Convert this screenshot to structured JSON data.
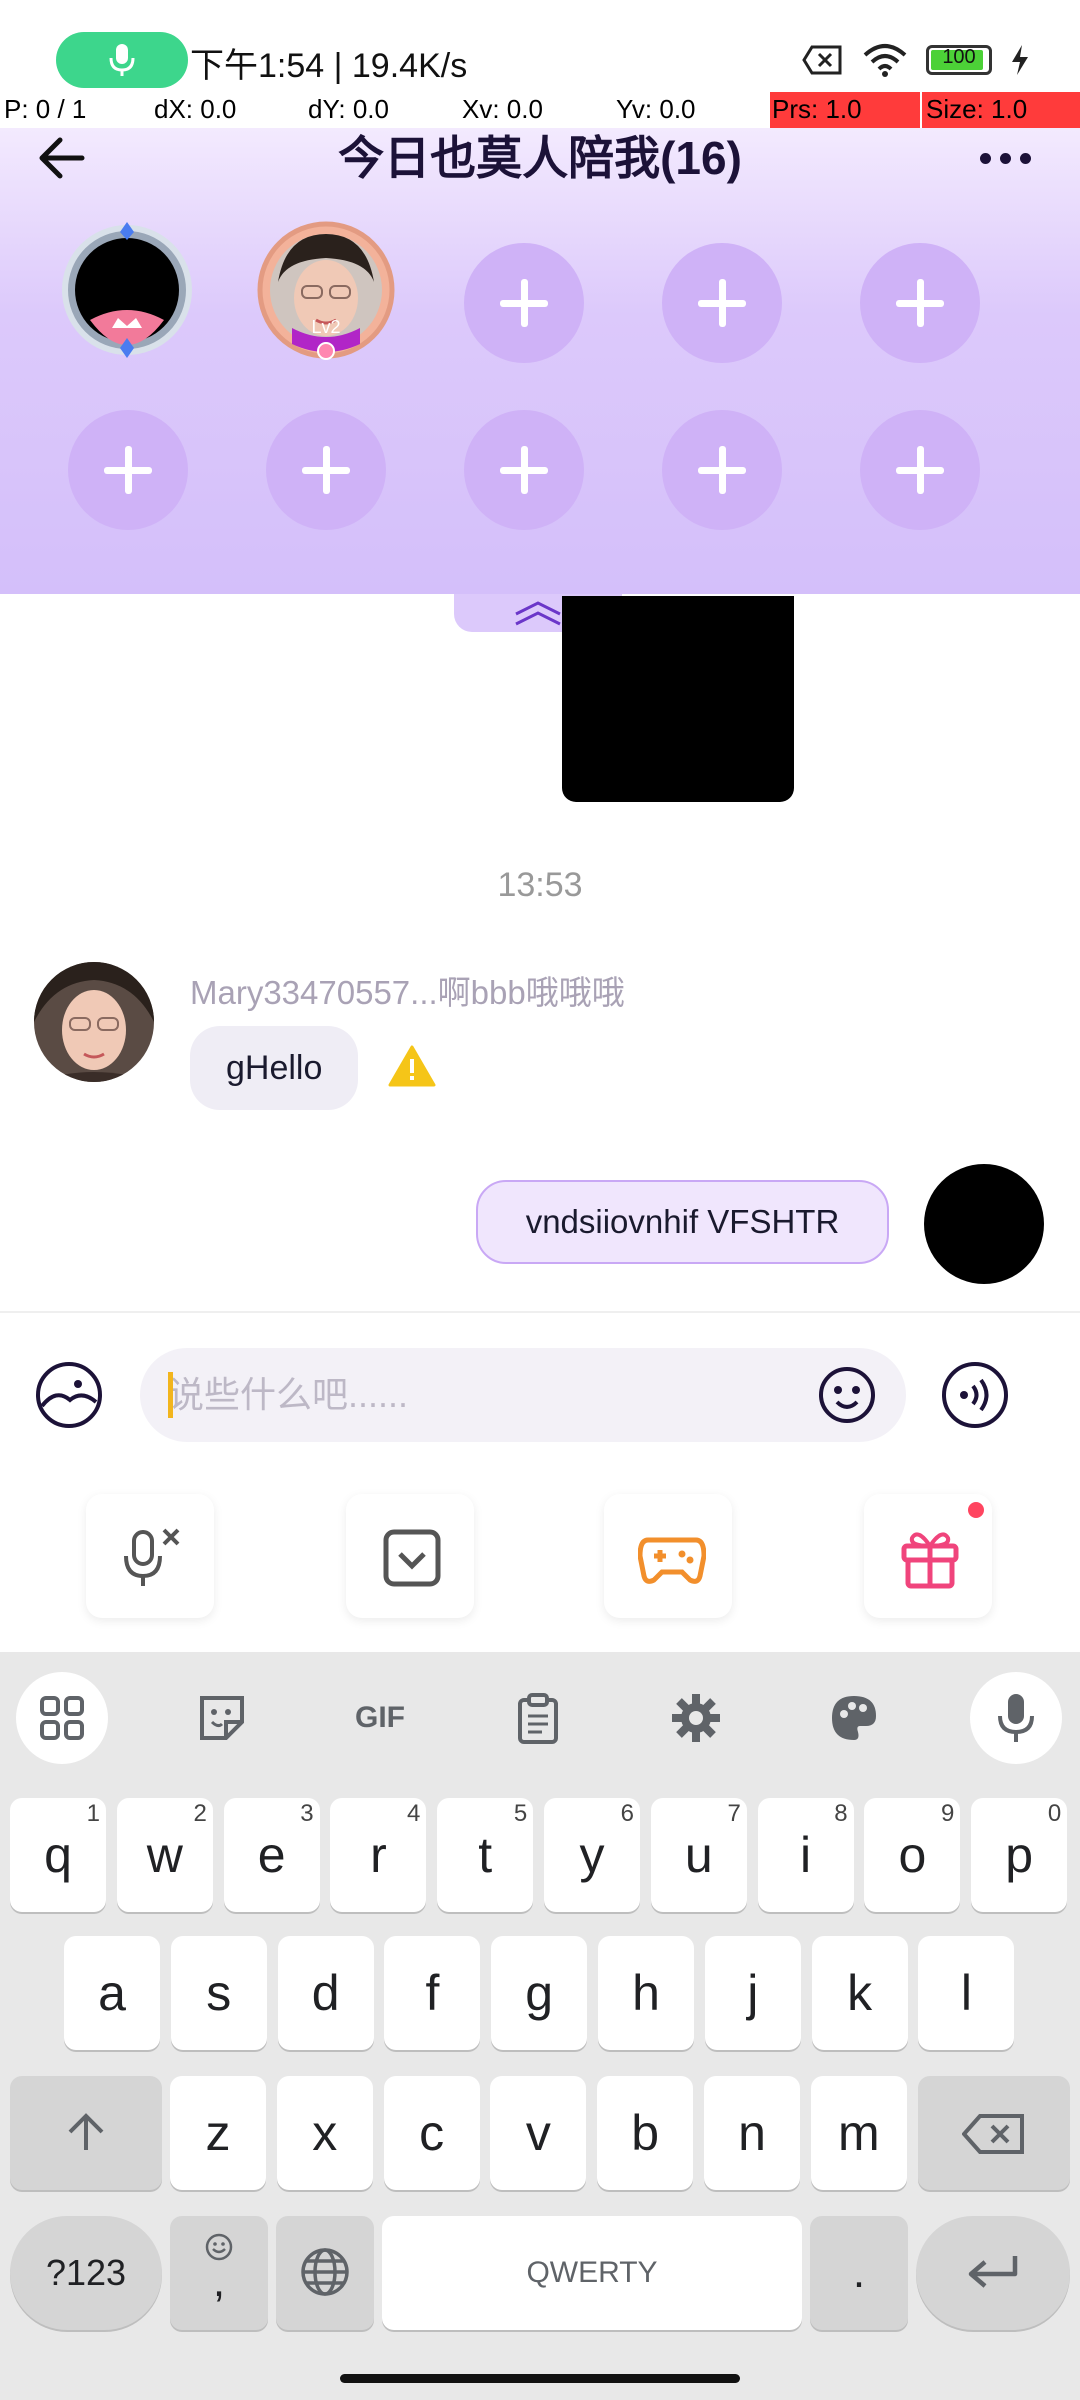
{
  "status_bar": {
    "time_speed": "下午1:54 | 19.4K/s",
    "battery": "100"
  },
  "debug": {
    "p": "P: 0 / 1",
    "dx": "dX: 0.0",
    "dy": "dY: 0.0",
    "xv": "Xv: 0.0",
    "yv": "Yv: 0.0",
    "prs": "Prs: 1.0",
    "size": "Size: 1.0"
  },
  "header": {
    "title": "今日也莫人陪我(16)"
  },
  "seats": {
    "level_badge": "Lv2"
  },
  "chat": {
    "timestamp": "13:53",
    "incoming": {
      "sender": "Mary33470557...啊bbb哦哦哦",
      "text": "gHello"
    },
    "outgoing": {
      "text": "vndsiiovnhif VFSHTR"
    }
  },
  "input": {
    "placeholder": "说些什么吧......"
  },
  "keyboard": {
    "row1": [
      {
        "ch": "q",
        "num": "1"
      },
      {
        "ch": "w",
        "num": "2"
      },
      {
        "ch": "e",
        "num": "3"
      },
      {
        "ch": "r",
        "num": "4"
      },
      {
        "ch": "t",
        "num": "5"
      },
      {
        "ch": "y",
        "num": "6"
      },
      {
        "ch": "u",
        "num": "7"
      },
      {
        "ch": "i",
        "num": "8"
      },
      {
        "ch": "o",
        "num": "9"
      },
      {
        "ch": "p",
        "num": "0"
      }
    ],
    "row2": [
      "a",
      "s",
      "d",
      "f",
      "g",
      "h",
      "j",
      "k",
      "l"
    ],
    "row3": [
      "z",
      "x",
      "c",
      "v",
      "b",
      "n",
      "m"
    ],
    "symbols_key": "?123",
    "comma_key": ",",
    "space_label": "QWERTY",
    "period_key": ".",
    "gif_label": "GIF"
  }
}
